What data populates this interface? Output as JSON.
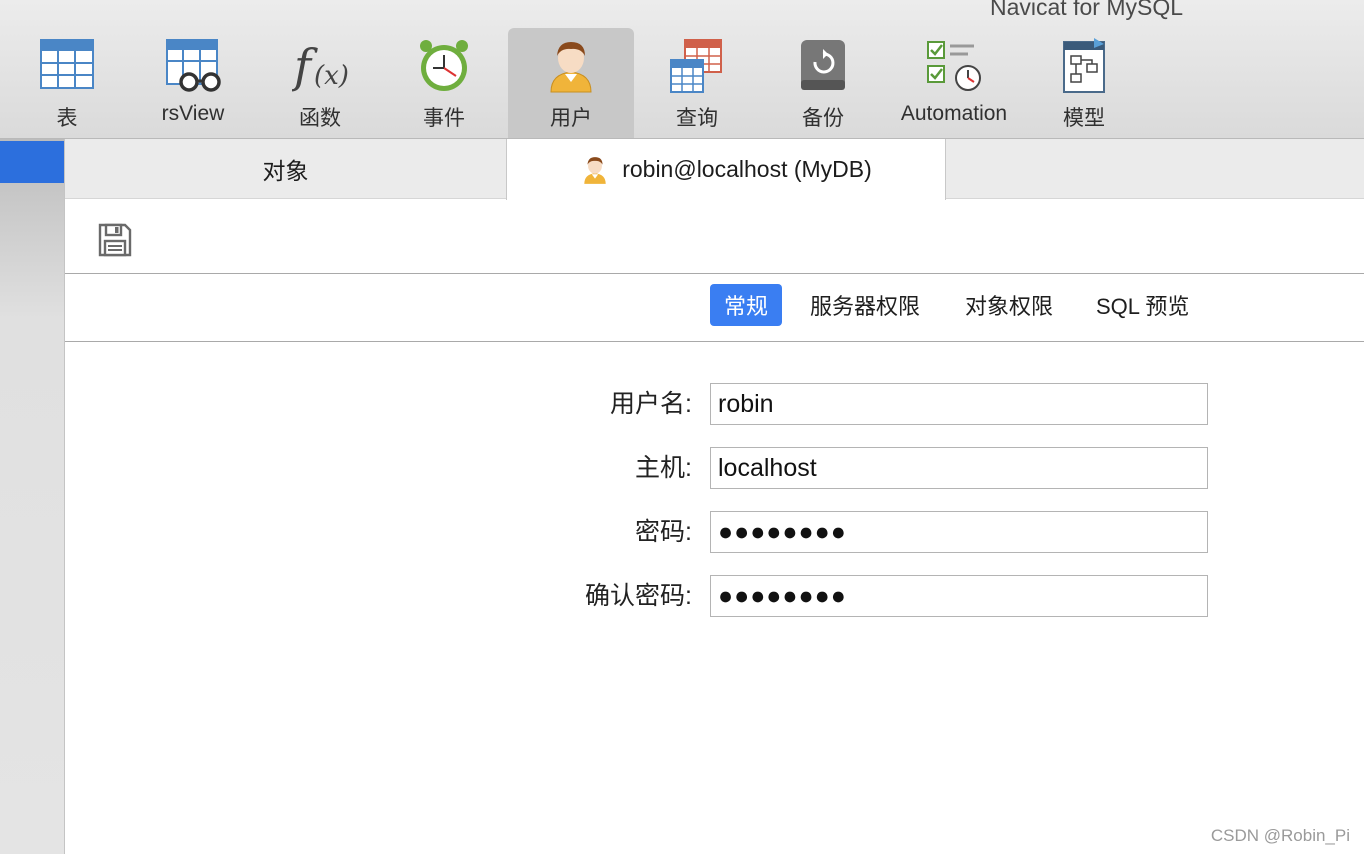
{
  "window": {
    "title": "Navicat for MySQL"
  },
  "toolbar": {
    "items": [
      {
        "label": "表",
        "icon": "table-icon"
      },
      {
        "label": "rsView",
        "icon": "view-icon"
      },
      {
        "label": "函数",
        "icon": "function-icon"
      },
      {
        "label": "事件",
        "icon": "event-clock-icon"
      },
      {
        "label": "用户",
        "icon": "user-icon",
        "active": true
      },
      {
        "label": "查询",
        "icon": "query-icon"
      },
      {
        "label": "备份",
        "icon": "backup-icon"
      },
      {
        "label": "Automation",
        "icon": "automation-icon"
      },
      {
        "label": "模型",
        "icon": "model-icon"
      }
    ]
  },
  "tabs": {
    "objects": "对象",
    "user": "robin@localhost (MyDB)"
  },
  "subtabs": {
    "general": "常规",
    "server_privileges": "服务器权限",
    "object_privileges": "对象权限",
    "sql_preview": "SQL 预览"
  },
  "form": {
    "username_label": "用户名:",
    "username_value": "robin",
    "host_label": "主机:",
    "host_value": "localhost",
    "password_label": "密码:",
    "password_value": "●●●●●●●●",
    "confirm_label": "确认密码:",
    "confirm_value": "●●●●●●●●"
  },
  "watermark": "CSDN @Robin_Pi",
  "colors": {
    "accent": "#3a7ef2",
    "sidebar_selection": "#2c6fdd",
    "toolbar_bg": "#e2e2e2"
  }
}
